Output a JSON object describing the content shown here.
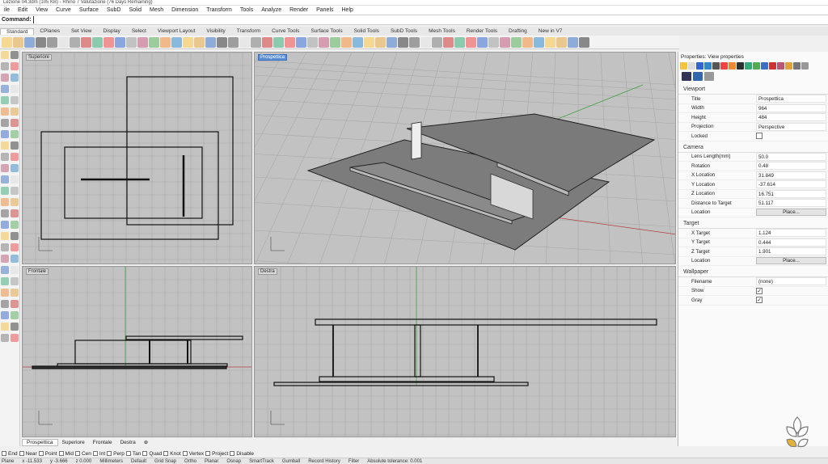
{
  "window": {
    "title": "Lezione 04.3dm (105 KB) - Rhino 7 Valutazione (76 Days Remaining)"
  },
  "menu": [
    "ile",
    "Edit",
    "View",
    "Curve",
    "Surface",
    "SubD",
    "Solid",
    "Mesh",
    "Dimension",
    "Transform",
    "Tools",
    "Analyze",
    "Render",
    "Panels",
    "Help"
  ],
  "command": {
    "label": "Command:"
  },
  "tabs": [
    "Standard",
    "CPlanes",
    "Set View",
    "Display",
    "Select",
    "Viewport Layout",
    "Visibility",
    "Transform",
    "Curve Tools",
    "Surface Tools",
    "Solid Tools",
    "SubD Tools",
    "Mesh Tools",
    "Render Tools",
    "Drafting",
    "New in V7"
  ],
  "viewports": {
    "top": "Superiore",
    "persp": "Prospettica",
    "front": "Frontale",
    "right": "Destra"
  },
  "viewport_tabs": [
    "Prospettica",
    "Superiore",
    "Frontale",
    "Destra"
  ],
  "osnap": {
    "items": [
      "End",
      "Near",
      "Point",
      "Mid",
      "Cen",
      "Int",
      "Perp",
      "Tan",
      "Quad",
      "Knot",
      "Vertex",
      "Project",
      "Disable"
    ]
  },
  "status": {
    "plane": "Plane",
    "x": "x -11.533",
    "y": "y -3.666",
    "z": "z 0.000",
    "units": "Millimeters",
    "layer": "Default",
    "buttons": [
      "Grid Snap",
      "Ortho",
      "Planar",
      "Osnap",
      "SmartTrack",
      "Gumball",
      "Record History",
      "Filter"
    ],
    "tolerance": "Absolute tolerance: 0.001"
  },
  "panel": {
    "header": "Properties: View properties",
    "viewport_section": "Viewport",
    "viewport": [
      {
        "k": "Title",
        "v": "Prospettica"
      },
      {
        "k": "Width",
        "v": "964"
      },
      {
        "k": "Height",
        "v": "484"
      },
      {
        "k": "Projection",
        "v": "Perspective"
      },
      {
        "k": "Locked",
        "v": ""
      }
    ],
    "camera_section": "Camera",
    "camera": [
      {
        "k": "Lens Length(mm)",
        "v": "50.0"
      },
      {
        "k": "Rotation",
        "v": "0.48"
      },
      {
        "k": "X Location",
        "v": "31.849"
      },
      {
        "k": "Y Location",
        "v": "-37.614"
      },
      {
        "k": "Z Location",
        "v": "16.751"
      },
      {
        "k": "Distance to Target",
        "v": "51.117"
      },
      {
        "k": "Location",
        "v": "Place..."
      }
    ],
    "target_section": "Target",
    "target": [
      {
        "k": "X Target",
        "v": "1.124"
      },
      {
        "k": "Y Target",
        "v": "0.444"
      },
      {
        "k": "Z Target",
        "v": "1.901"
      },
      {
        "k": "Location",
        "v": "Place..."
      }
    ],
    "wallpaper_section": "Wallpaper",
    "wallpaper": [
      {
        "k": "Filename",
        "v": "(none)"
      },
      {
        "k": "Show",
        "v": "✓"
      },
      {
        "k": "Gray",
        "v": "✓"
      }
    ]
  },
  "colors": {
    "viewport_bg": "#c2c2c2",
    "active_label": "#5b8fd6",
    "x_axis": "#b04040",
    "y_axis": "#40a040"
  }
}
